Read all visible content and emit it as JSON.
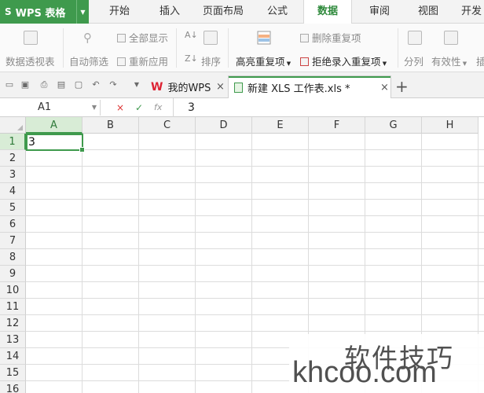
{
  "app": {
    "title": "WPS 表格",
    "logo": "S"
  },
  "menu_tabs": [
    "开始",
    "插入",
    "页面布局",
    "公式",
    "数据",
    "审阅",
    "视图",
    "开发"
  ],
  "active_menu_tab": "数据",
  "ribbon": {
    "pivot_table": "数据透视表",
    "auto_filter": "自动筛选",
    "show_all": "全部显示",
    "reapply": "重新应用",
    "sort": "排序",
    "highlight_duplicates": "高亮重复项",
    "delete_duplicates": "删除重复项",
    "reject_duplicates": "拒绝录入重复项",
    "split_column": "分列",
    "validity": "有效性",
    "insert_partial": "插"
  },
  "doc_tabs": [
    {
      "label": "我的WPS"
    },
    {
      "label": "新建 XLS 工作表.xls *"
    }
  ],
  "formula_bar": {
    "cell_ref": "A1",
    "fx": "fx",
    "cancel": "×",
    "confirm": "✓",
    "value": "3"
  },
  "columns": [
    "A",
    "B",
    "C",
    "D",
    "E",
    "F",
    "G",
    "H"
  ],
  "rows": [
    "1",
    "2",
    "3",
    "4",
    "5",
    "6",
    "7",
    "8",
    "9",
    "10",
    "11",
    "12",
    "13",
    "14",
    "15",
    "16"
  ],
  "cells": {
    "A1": "3"
  },
  "watermark": {
    "cn": "软件技巧",
    "en": "khcoo.com"
  },
  "colors": {
    "accent": "#3f9a4d",
    "header_bg": "#f1f1f1"
  },
  "icons": [
    "wps-logo-icon",
    "save-icon",
    "undo-icon",
    "redo-icon",
    "print-icon",
    "close-icon",
    "add-tab-icon",
    "dropdown-icon"
  ]
}
